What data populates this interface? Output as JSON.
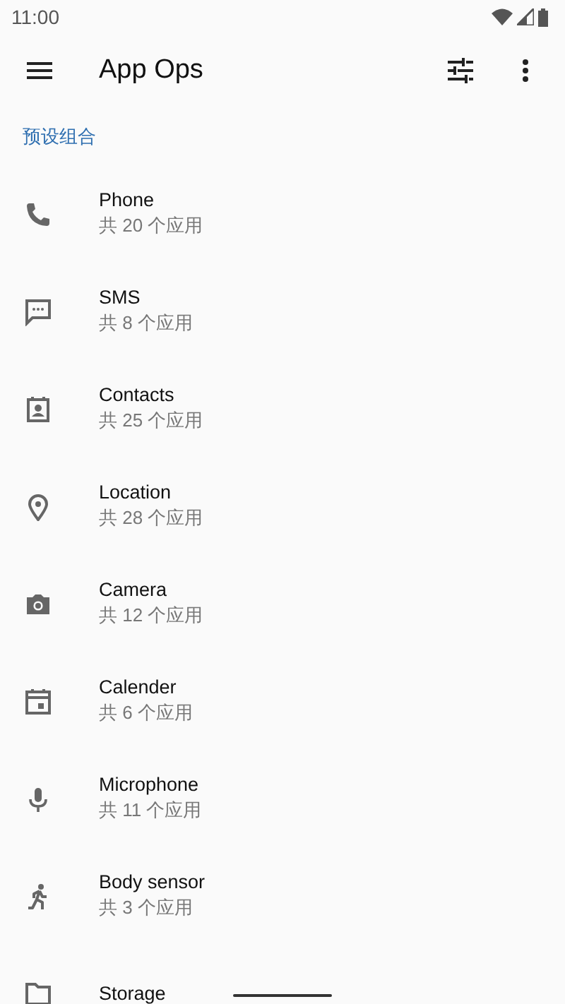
{
  "status_bar": {
    "time": "11:00"
  },
  "toolbar": {
    "title": "App Ops"
  },
  "section": {
    "header": "预设组合"
  },
  "items": [
    {
      "title": "Phone",
      "subtitle": "共 20 个应用"
    },
    {
      "title": "SMS",
      "subtitle": "共 8 个应用"
    },
    {
      "title": "Contacts",
      "subtitle": "共 25 个应用"
    },
    {
      "title": "Location",
      "subtitle": "共 28 个应用"
    },
    {
      "title": "Camera",
      "subtitle": "共 12 个应用"
    },
    {
      "title": "Calender",
      "subtitle": "共 6 个应用"
    },
    {
      "title": "Microphone",
      "subtitle": "共 11 个应用"
    },
    {
      "title": "Body sensor",
      "subtitle": "共 3 个应用"
    },
    {
      "title": "Storage"
    }
  ]
}
